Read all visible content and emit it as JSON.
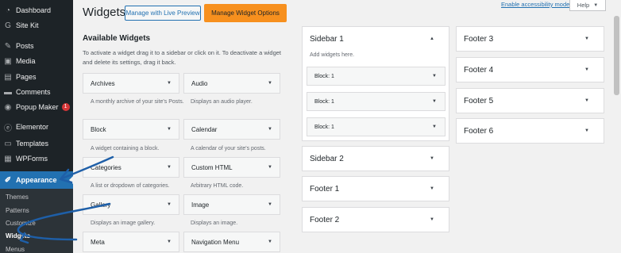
{
  "sidebar": {
    "items": [
      {
        "label": "Dashboard",
        "icon": "dashboard-icon",
        "glyph": "◔"
      },
      {
        "label": "Site Kit",
        "icon": "site-kit-icon",
        "glyph": "G"
      },
      {
        "label": "Posts",
        "icon": "posts-icon",
        "glyph": "✎"
      },
      {
        "label": "Media",
        "icon": "media-icon",
        "glyph": "▣"
      },
      {
        "label": "Pages",
        "icon": "pages-icon",
        "glyph": "▤"
      },
      {
        "label": "Comments",
        "icon": "comments-icon",
        "glyph": "▬"
      },
      {
        "label": "Popup Maker",
        "icon": "popup-maker-icon",
        "glyph": "◉",
        "badge": "1"
      },
      {
        "label": "Elementor",
        "icon": "elementor-icon",
        "glyph": "ⓔ"
      },
      {
        "label": "Templates",
        "icon": "templates-icon",
        "glyph": "▭"
      },
      {
        "label": "WPForms",
        "icon": "wpforms-icon",
        "glyph": "▦"
      },
      {
        "label": "Appearance",
        "icon": "appearance-icon",
        "glyph": "✐"
      }
    ],
    "submenu": [
      "Themes",
      "Patterns",
      "Customize",
      "Widgets",
      "Menus"
    ]
  },
  "header": {
    "title": "Widgets",
    "live_preview_label": "Manage with Live Preview",
    "manage_options_label": "Manage Widget Options",
    "accessibility_label": "Enable accessibility mode",
    "help_label": "Help",
    "help_chevron": "▼"
  },
  "available": {
    "title": "Available Widgets",
    "description": "To activate a widget drag it to a sidebar or click on it. To deactivate a widget and delete its settings, drag it back.",
    "widgets": [
      {
        "name": "Archives",
        "desc": "A monthly archive of your site's Posts."
      },
      {
        "name": "Audio",
        "desc": "Displays an audio player."
      },
      {
        "name": "Block",
        "desc": "A widget containing a block."
      },
      {
        "name": "Calendar",
        "desc": "A calendar of your site's posts."
      },
      {
        "name": "Categories",
        "desc": "A list or dropdown of categories."
      },
      {
        "name": "Custom HTML",
        "desc": "Arbitrary HTML code."
      },
      {
        "name": "Gallery",
        "desc": "Displays an image gallery."
      },
      {
        "name": "Image",
        "desc": "Displays an image."
      },
      {
        "name": "Meta",
        "desc": ""
      },
      {
        "name": "Navigation Menu",
        "desc": ""
      }
    ]
  },
  "areas": {
    "sidebar1": {
      "title": "Sidebar 1",
      "hint": "Add widgets here.",
      "blocks": [
        "Block: 1",
        "Block: 1",
        "Block: 1"
      ]
    },
    "left_column": [
      "Sidebar 2",
      "Footer 1",
      "Footer 2"
    ],
    "right_column": [
      "Footer 3",
      "Footer 4",
      "Footer 5",
      "Footer 6"
    ]
  },
  "glyphs": {
    "expand": "▼",
    "collapse": "▲"
  },
  "colors": {
    "admin_bar": "#1d2327",
    "active": "#2271b1",
    "orange_button": "#f7901e",
    "badge": "#d63638",
    "annotation": "#1e5fa8"
  }
}
